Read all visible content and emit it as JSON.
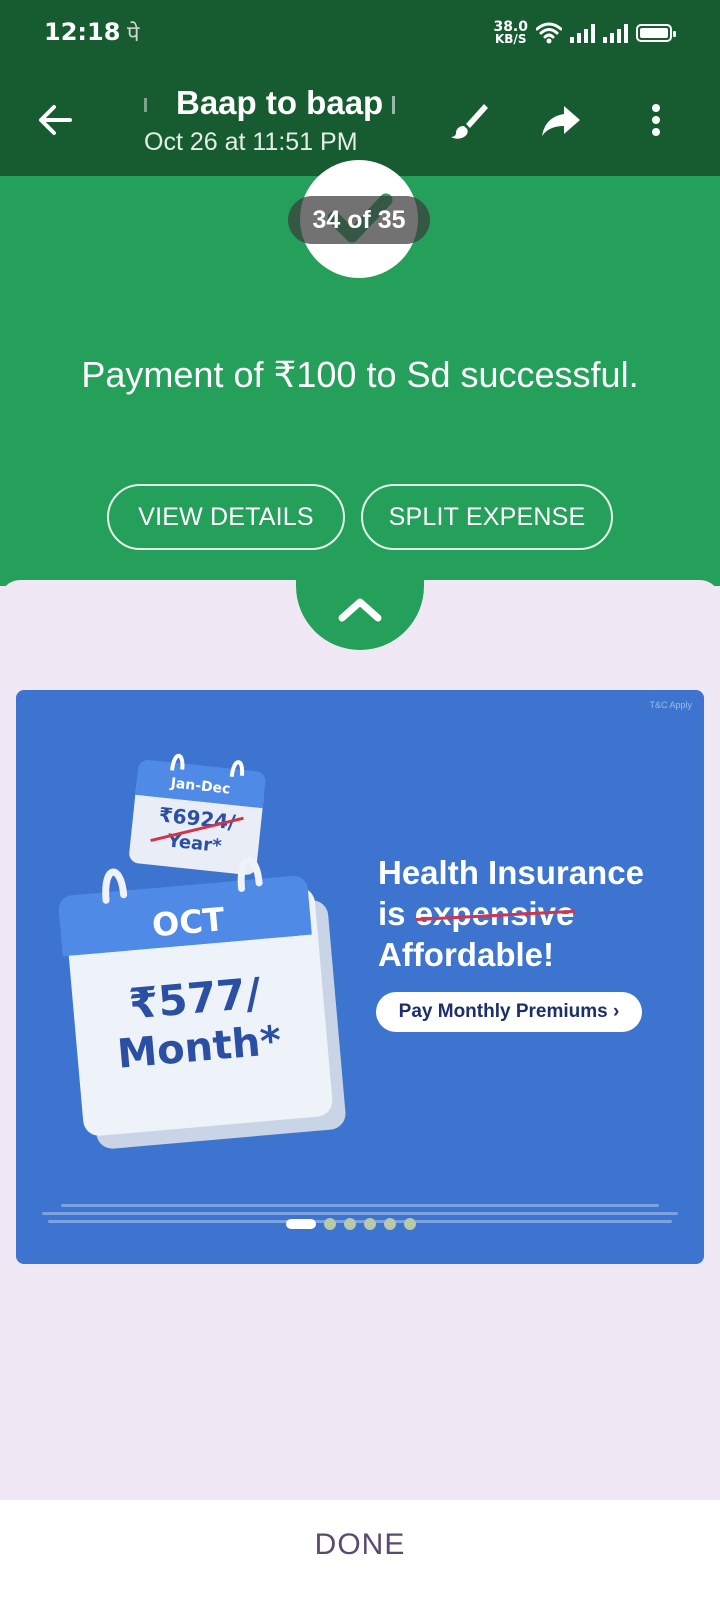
{
  "status_bar": {
    "time": "12:18",
    "notification_glyph": "पे",
    "net_speed_value": "38.0",
    "net_speed_unit": "KB/S",
    "icons": [
      "wifi-icon",
      "signal-icon",
      "signal-icon",
      "battery-icon"
    ]
  },
  "header": {
    "title": "Baap to baap",
    "subtitle": "Oct 26 at 11:51 PM",
    "icons": [
      "back-arrow-icon",
      "brush-icon",
      "share-icon",
      "more-vert-icon"
    ]
  },
  "success": {
    "counter": "34 of 35",
    "message": "Payment of ₹100 to Sd successful.",
    "view_details_label": "VIEW DETAILS",
    "split_expense_label": "SPLIT EXPENSE",
    "accent": "#24a05a"
  },
  "banner": {
    "tc_note": "T&C Apply",
    "small_calendar_header": "Jan-Dec",
    "small_calendar_price": "₹6924/",
    "small_calendar_unit": "Year*",
    "big_calendar_header": "OCT",
    "big_calendar_price": "₹577/",
    "big_calendar_unit": "Month*",
    "headline_line1": "Health Insurance",
    "headline_is": "is",
    "headline_struck": "expensive",
    "headline_line3": "Affordable!",
    "cta_label": "Pay Monthly Premiums ›",
    "carousel_total": 6,
    "carousel_active": 1,
    "background": "#3c74d0"
  },
  "footer": {
    "done_label": "DONE"
  }
}
